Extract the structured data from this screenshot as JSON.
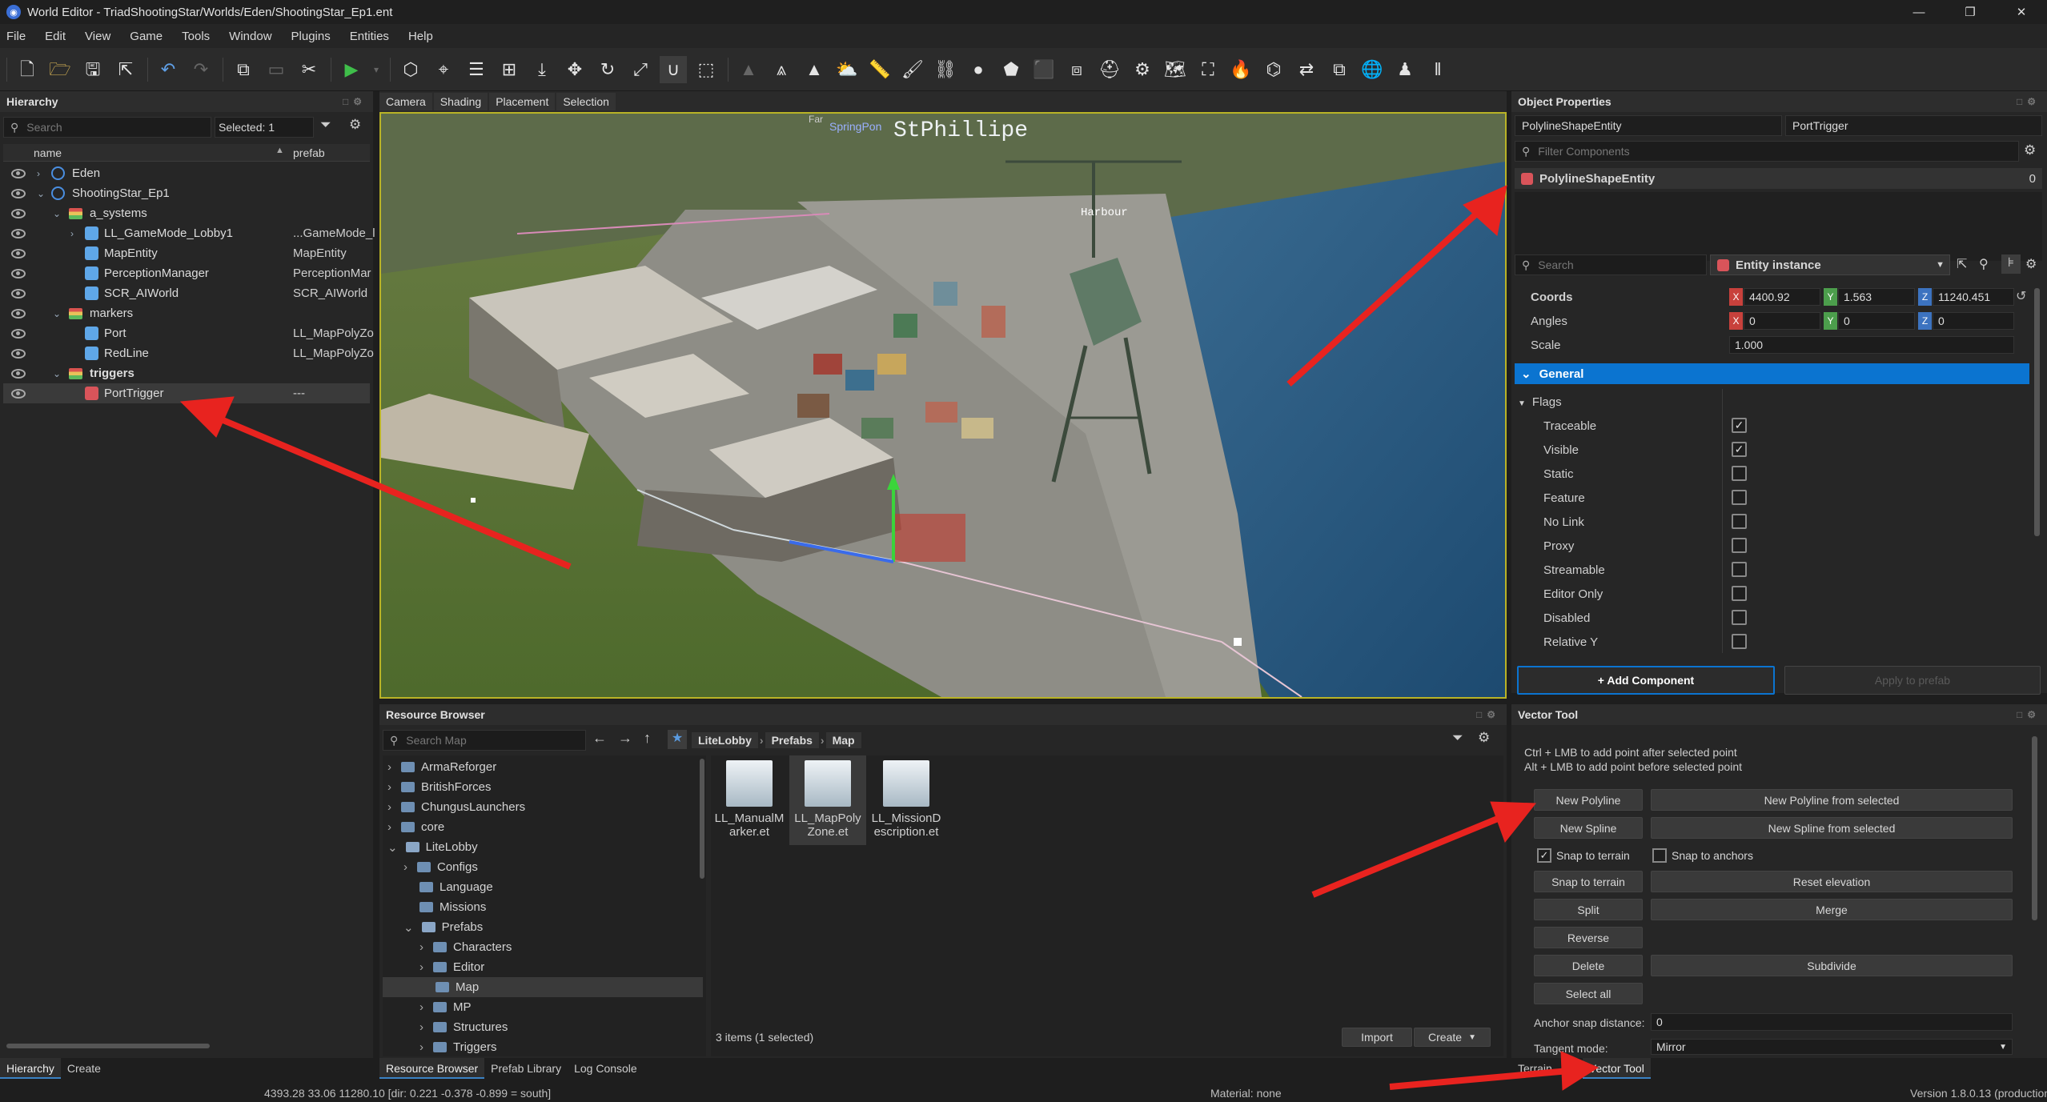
{
  "window": {
    "title": "World Editor - TriadShootingStar/Worlds/Eden/ShootingStar_Ep1.ent"
  },
  "menu": [
    "File",
    "Edit",
    "View",
    "Game",
    "Tools",
    "Window",
    "Plugins",
    "Entities",
    "Help"
  ],
  "hierarchy": {
    "title": "Hierarchy",
    "search_placeholder": "Search",
    "selected": "Selected: 1",
    "col_name": "name",
    "col_prefab": "prefab",
    "rows": [
      {
        "name": "Eden",
        "prefab": ""
      },
      {
        "name": "ShootingStar_Ep1",
        "prefab": ""
      },
      {
        "name": "a_systems",
        "prefab": ""
      },
      {
        "name": "LL_GameMode_Lobby1",
        "prefab": "...GameMode_l"
      },
      {
        "name": "MapEntity",
        "prefab": "MapEntity"
      },
      {
        "name": "PerceptionManager",
        "prefab": "PerceptionMar"
      },
      {
        "name": "SCR_AIWorld",
        "prefab": "SCR_AIWorld"
      },
      {
        "name": "markers",
        "prefab": ""
      },
      {
        "name": "Port",
        "prefab": "LL_MapPolyZo"
      },
      {
        "name": "RedLine",
        "prefab": "LL_MapPolyZo"
      },
      {
        "name": "triggers",
        "prefab": ""
      },
      {
        "name": "PortTrigger",
        "prefab": "---"
      }
    ],
    "tabs": [
      "Hierarchy",
      "Create"
    ]
  },
  "viewport": {
    "tabs": [
      "Camera",
      "Shading",
      "Placement",
      "Selection"
    ],
    "labels": {
      "town": "StPhillipe",
      "harbour": "Harbour",
      "small1": "SpringPon",
      "small2": "Far"
    }
  },
  "object_properties": {
    "title": "Object Properties",
    "class_name": "PolylineShapeEntity",
    "entity_name": "PortTrigger",
    "filter_placeholder": "Filter Components",
    "component": "PolylineShapeEntity",
    "component_count": "0",
    "search_placeholder": "Search",
    "instance_label": "Entity instance",
    "coords": {
      "label": "Coords",
      "x": "4400.92",
      "y": "1.563",
      "z": "11240.451"
    },
    "angles": {
      "label": "Angles",
      "x": "0",
      "y": "0",
      "z": "0"
    },
    "scale": {
      "label": "Scale",
      "value": "1.000"
    },
    "section": "General",
    "flags_label": "Flags",
    "flags": [
      {
        "label": "Traceable",
        "checked": true
      },
      {
        "label": "Visible",
        "checked": true
      },
      {
        "label": "Static",
        "checked": false
      },
      {
        "label": "Feature",
        "checked": false
      },
      {
        "label": "No Link",
        "checked": false
      },
      {
        "label": "Proxy",
        "checked": false
      },
      {
        "label": "Streamable",
        "checked": false
      },
      {
        "label": "Editor Only",
        "checked": false
      },
      {
        "label": "Disabled",
        "checked": false
      },
      {
        "label": "Relative Y",
        "checked": false
      }
    ],
    "add_component": "+ Add Component",
    "apply_prefab": "Apply to prefab"
  },
  "resource_browser": {
    "title": "Resource Browser",
    "search_placeholder": "Search Map",
    "breadcrumb": [
      "LiteLobby",
      "Prefabs",
      "Map"
    ],
    "tree": [
      {
        "label": "ArmaReforger",
        "depth": 0,
        "open": false
      },
      {
        "label": "BritishForces",
        "depth": 0,
        "open": false
      },
      {
        "label": "ChungusLaunchers",
        "depth": 0,
        "open": false
      },
      {
        "label": "core",
        "depth": 0,
        "open": false
      },
      {
        "label": "LiteLobby",
        "depth": 0,
        "open": true
      },
      {
        "label": "Configs",
        "depth": 1,
        "open": false
      },
      {
        "label": "Language",
        "depth": 1,
        "open": false
      },
      {
        "label": "Missions",
        "depth": 1,
        "open": false
      },
      {
        "label": "Prefabs",
        "depth": 1,
        "open": true
      },
      {
        "label": "Characters",
        "depth": 2,
        "open": false
      },
      {
        "label": "Editor",
        "depth": 2,
        "open": false
      },
      {
        "label": "Map",
        "depth": 2,
        "open": false
      },
      {
        "label": "MP",
        "depth": 2,
        "open": false
      },
      {
        "label": "Structures",
        "depth": 2,
        "open": false
      },
      {
        "label": "Triggers",
        "depth": 2,
        "open": false
      }
    ],
    "assets": [
      {
        "l1": "LL_ManualM",
        "l2": "arker.et"
      },
      {
        "l1": "LL_MapPoly",
        "l2": "Zone.et"
      },
      {
        "l1": "LL_MissionD",
        "l2": "escription.et"
      }
    ],
    "status": "3 items (1 selected)",
    "import": "Import",
    "create": "Create",
    "tabs": [
      "Resource Browser",
      "Prefab Library",
      "Log Console"
    ]
  },
  "vector_tool": {
    "title": "Vector Tool",
    "hint1": "Ctrl + LMB to add point after selected point",
    "hint2": "Alt + LMB to add point before selected point",
    "new_polyline": "New Polyline",
    "new_polyline_sel": "New Polyline from selected",
    "new_spline": "New Spline",
    "new_spline_sel": "New Spline from selected",
    "snap_terrain_chk": "Snap to terrain",
    "snap_anchors_chk": "Snap to anchors",
    "snap_terrain_btn": "Snap to terrain",
    "reset_elevation": "Reset elevation",
    "split": "Split",
    "merge": "Merge",
    "reverse": "Reverse",
    "delete": "Delete",
    "subdivide": "Subdivide",
    "select_all": "Select all",
    "anchor_label": "Anchor snap distance:",
    "anchor_value": "0",
    "tangent_label": "Tangent mode:",
    "tangent_value": "Mirror",
    "tabs": [
      "Terrain",
      "Vector Tool"
    ]
  },
  "status": {
    "coords": "4393.28     33.06  11280.10 [dir: 0.221 -0.378 -0.899 = south]",
    "material": "Material: none",
    "version": "Version 1.8.0.13 (production)"
  },
  "colors": {
    "accent": "#0b74d0",
    "annotation": "#e8231f",
    "viewport_border": "#b9b326"
  }
}
